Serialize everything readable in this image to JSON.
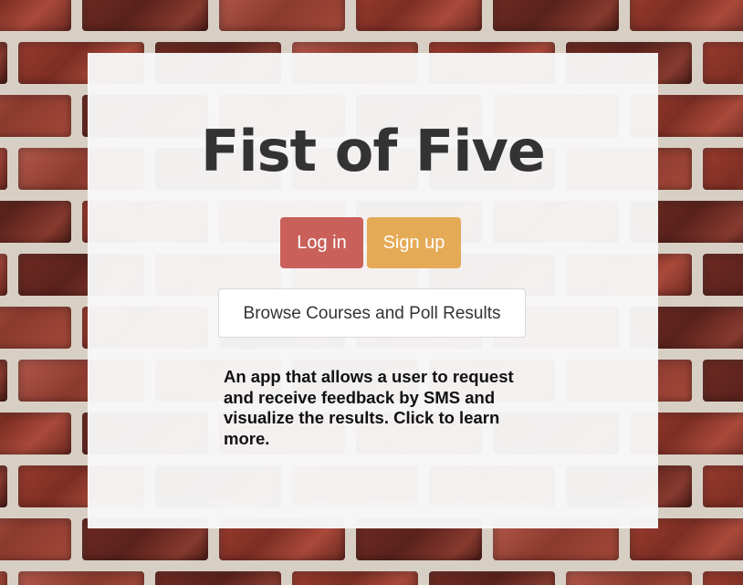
{
  "page": {
    "title": "Fist of Five"
  },
  "actions": {
    "login_label": "Log in",
    "signup_label": "Sign up",
    "browse_label": "Browse Courses and Poll Results"
  },
  "description": {
    "text": "An app that allows a user to request and receive feedback by SMS and visualize the results. Click to learn more."
  },
  "colors": {
    "login_button": "#c9605a",
    "signup_button": "#e5aa56",
    "panel": "#f8f8f8",
    "title_text": "#333333"
  }
}
